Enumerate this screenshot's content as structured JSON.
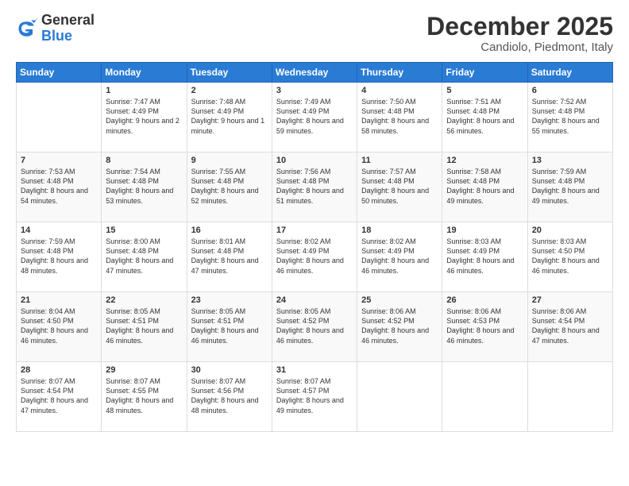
{
  "logo": {
    "general": "General",
    "blue": "Blue"
  },
  "header": {
    "month": "December 2025",
    "location": "Candiolo, Piedmont, Italy"
  },
  "days": [
    "Sunday",
    "Monday",
    "Tuesday",
    "Wednesday",
    "Thursday",
    "Friday",
    "Saturday"
  ],
  "weeks": [
    [
      {
        "day": "",
        "sunrise": "",
        "sunset": "",
        "daylight": ""
      },
      {
        "day": "1",
        "sunrise": "7:47 AM",
        "sunset": "4:49 PM",
        "daylight": "9 hours and 2 minutes."
      },
      {
        "day": "2",
        "sunrise": "7:48 AM",
        "sunset": "4:49 PM",
        "daylight": "9 hours and 1 minute."
      },
      {
        "day": "3",
        "sunrise": "7:49 AM",
        "sunset": "4:49 PM",
        "daylight": "8 hours and 59 minutes."
      },
      {
        "day": "4",
        "sunrise": "7:50 AM",
        "sunset": "4:48 PM",
        "daylight": "8 hours and 58 minutes."
      },
      {
        "day": "5",
        "sunrise": "7:51 AM",
        "sunset": "4:48 PM",
        "daylight": "8 hours and 56 minutes."
      },
      {
        "day": "6",
        "sunrise": "7:52 AM",
        "sunset": "4:48 PM",
        "daylight": "8 hours and 55 minutes."
      }
    ],
    [
      {
        "day": "7",
        "sunrise": "7:53 AM",
        "sunset": "4:48 PM",
        "daylight": "8 hours and 54 minutes."
      },
      {
        "day": "8",
        "sunrise": "7:54 AM",
        "sunset": "4:48 PM",
        "daylight": "8 hours and 53 minutes."
      },
      {
        "day": "9",
        "sunrise": "7:55 AM",
        "sunset": "4:48 PM",
        "daylight": "8 hours and 52 minutes."
      },
      {
        "day": "10",
        "sunrise": "7:56 AM",
        "sunset": "4:48 PM",
        "daylight": "8 hours and 51 minutes."
      },
      {
        "day": "11",
        "sunrise": "7:57 AM",
        "sunset": "4:48 PM",
        "daylight": "8 hours and 50 minutes."
      },
      {
        "day": "12",
        "sunrise": "7:58 AM",
        "sunset": "4:48 PM",
        "daylight": "8 hours and 49 minutes."
      },
      {
        "day": "13",
        "sunrise": "7:59 AM",
        "sunset": "4:48 PM",
        "daylight": "8 hours and 49 minutes."
      }
    ],
    [
      {
        "day": "14",
        "sunrise": "7:59 AM",
        "sunset": "4:48 PM",
        "daylight": "8 hours and 48 minutes."
      },
      {
        "day": "15",
        "sunrise": "8:00 AM",
        "sunset": "4:48 PM",
        "daylight": "8 hours and 47 minutes."
      },
      {
        "day": "16",
        "sunrise": "8:01 AM",
        "sunset": "4:48 PM",
        "daylight": "8 hours and 47 minutes."
      },
      {
        "day": "17",
        "sunrise": "8:02 AM",
        "sunset": "4:49 PM",
        "daylight": "8 hours and 46 minutes."
      },
      {
        "day": "18",
        "sunrise": "8:02 AM",
        "sunset": "4:49 PM",
        "daylight": "8 hours and 46 minutes."
      },
      {
        "day": "19",
        "sunrise": "8:03 AM",
        "sunset": "4:49 PM",
        "daylight": "8 hours and 46 minutes."
      },
      {
        "day": "20",
        "sunrise": "8:03 AM",
        "sunset": "4:50 PM",
        "daylight": "8 hours and 46 minutes."
      }
    ],
    [
      {
        "day": "21",
        "sunrise": "8:04 AM",
        "sunset": "4:50 PM",
        "daylight": "8 hours and 46 minutes."
      },
      {
        "day": "22",
        "sunrise": "8:05 AM",
        "sunset": "4:51 PM",
        "daylight": "8 hours and 46 minutes."
      },
      {
        "day": "23",
        "sunrise": "8:05 AM",
        "sunset": "4:51 PM",
        "daylight": "8 hours and 46 minutes."
      },
      {
        "day": "24",
        "sunrise": "8:05 AM",
        "sunset": "4:52 PM",
        "daylight": "8 hours and 46 minutes."
      },
      {
        "day": "25",
        "sunrise": "8:06 AM",
        "sunset": "4:52 PM",
        "daylight": "8 hours and 46 minutes."
      },
      {
        "day": "26",
        "sunrise": "8:06 AM",
        "sunset": "4:53 PM",
        "daylight": "8 hours and 46 minutes."
      },
      {
        "day": "27",
        "sunrise": "8:06 AM",
        "sunset": "4:54 PM",
        "daylight": "8 hours and 47 minutes."
      }
    ],
    [
      {
        "day": "28",
        "sunrise": "8:07 AM",
        "sunset": "4:54 PM",
        "daylight": "8 hours and 47 minutes."
      },
      {
        "day": "29",
        "sunrise": "8:07 AM",
        "sunset": "4:55 PM",
        "daylight": "8 hours and 48 minutes."
      },
      {
        "day": "30",
        "sunrise": "8:07 AM",
        "sunset": "4:56 PM",
        "daylight": "8 hours and 48 minutes."
      },
      {
        "day": "31",
        "sunrise": "8:07 AM",
        "sunset": "4:57 PM",
        "daylight": "8 hours and 49 minutes."
      },
      {
        "day": "",
        "sunrise": "",
        "sunset": "",
        "daylight": ""
      },
      {
        "day": "",
        "sunrise": "",
        "sunset": "",
        "daylight": ""
      },
      {
        "day": "",
        "sunrise": "",
        "sunset": "",
        "daylight": ""
      }
    ]
  ],
  "labels": {
    "sunrise": "Sunrise:",
    "sunset": "Sunset:",
    "daylight": "Daylight:"
  }
}
